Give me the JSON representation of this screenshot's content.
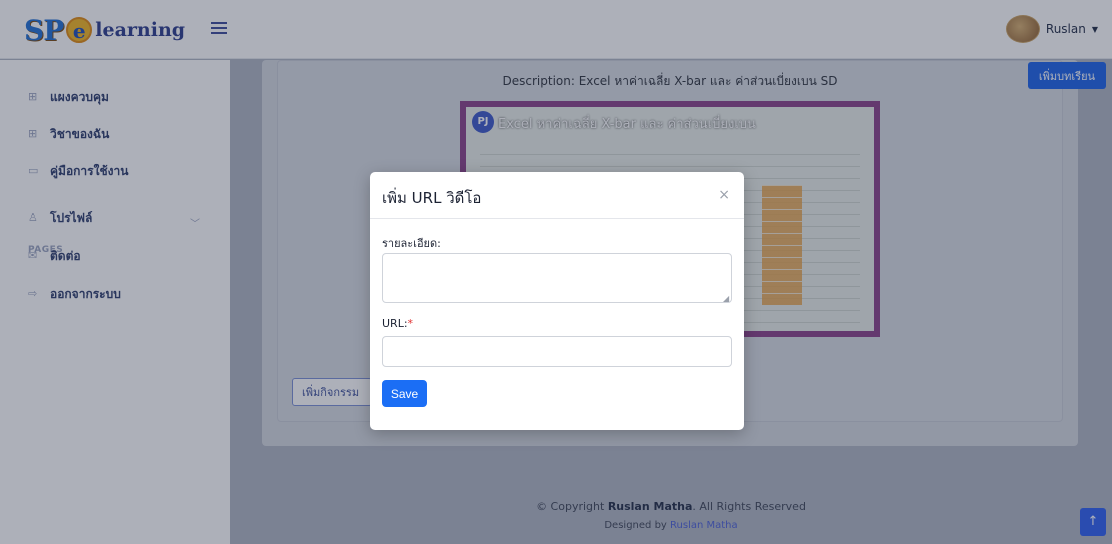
{
  "header": {
    "logo_sp": "SP",
    "logo_e": "e",
    "logo_learning": "learning",
    "user_name": "Ruslan"
  },
  "sidebar": {
    "items": [
      {
        "label": "แผงควบคุม",
        "icon": "grid-icon"
      },
      {
        "label": "วิชาของฉัน",
        "icon": "grid-icon"
      },
      {
        "label": "คู่มือการใช้งาน",
        "icon": "book-icon"
      },
      {
        "label": "โปรไฟล์",
        "icon": "person-icon"
      },
      {
        "label": "ติดต่อ",
        "icon": "envelope-icon"
      },
      {
        "label": "ออกจากระบบ",
        "icon": "logout-icon"
      }
    ],
    "section_heading": "PAGES"
  },
  "main": {
    "add_lesson_label": "เพิ่มบทเรียน",
    "description": "Description: Excel หาค่าเฉลี่ย X-bar และ ค่าส่วนเบี่ยงเบน SD",
    "video_title": "Excel หาค่าเฉลี่ย X-bar และ ค่าส่วนเบี่ยงเบน",
    "video_logo": "PJ",
    "activity_button": "เพิ่มกิจกรรม"
  },
  "modal": {
    "title": "เพิ่ม URL วิดีโอ",
    "close": "×",
    "detail_label": "รายละเอียด:",
    "detail_value": "",
    "url_label": "URL:",
    "url_required": "*",
    "url_value": "",
    "save_label": "Save"
  },
  "footer": {
    "copyright_prefix": "© Copyright ",
    "copyright_name": "Ruslan Matha",
    "copyright_suffix": ". All Rights Reserved",
    "designed_prefix": "Designed by ",
    "designed_name": "Ruslan Matha"
  },
  "scroll_top": "↑",
  "colors": {
    "primary": "#1b6ef5",
    "sidebar_text": "#2b3a6b",
    "required": "#e03131"
  }
}
